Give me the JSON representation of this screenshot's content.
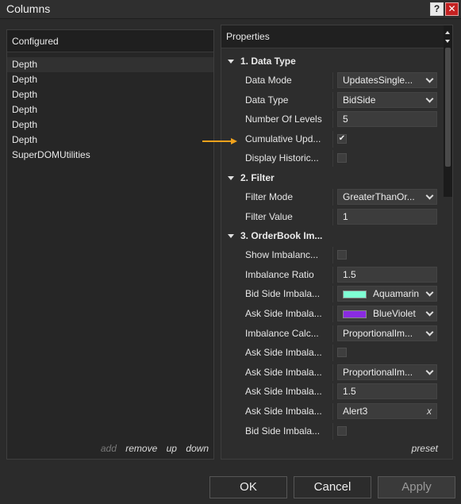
{
  "window": {
    "title": "Columns",
    "help_label": "?",
    "close_label": "✕"
  },
  "left_panel": {
    "header": "Configured",
    "items": [
      "Depth",
      "Depth",
      "Depth",
      "Depth",
      "Depth",
      "Depth",
      "SuperDOMUtilities"
    ],
    "actions": {
      "add": "add",
      "remove": "remove",
      "up": "up",
      "down": "down"
    }
  },
  "right_panel": {
    "header": "Properties",
    "categories": {
      "data_type": "1. Data Type",
      "filter": "2. Filter",
      "orderbook": "3. OrderBook Im..."
    },
    "props": {
      "data_mode": {
        "label": "Data Mode",
        "value": "UpdatesSingle..."
      },
      "data_type": {
        "label": "Data Type",
        "value": "BidSide"
      },
      "number_of_levels": {
        "label": "Number Of Levels",
        "value": "5"
      },
      "cumulative_upd": {
        "label": "Cumulative Upd...",
        "value": "✔"
      },
      "display_historic": {
        "label": "Display Historic..."
      },
      "filter_mode": {
        "label": "Filter Mode",
        "value": "GreaterThanOr..."
      },
      "filter_value": {
        "label": "Filter Value",
        "value": "1"
      },
      "show_imbalance": {
        "label": "Show Imbalanc..."
      },
      "imbalance_ratio": {
        "label": "Imbalance Ratio",
        "value": "1.5"
      },
      "bid_side_color": {
        "label": "Bid Side Imbala...",
        "value": "Aquamarine",
        "color": "#7fffd4"
      },
      "ask_side_color": {
        "label": "Ask Side Imbala...",
        "value": "BlueViolet",
        "color": "#8a2be2"
      },
      "imbalance_calc": {
        "label": "Imbalance Calc...",
        "value": "ProportionalIm..."
      },
      "ask_side_check": {
        "label": "Ask Side Imbala..."
      },
      "ask_side_calc": {
        "label": "Ask Side Imbala...",
        "value": "ProportionalIm..."
      },
      "ask_side_ratio": {
        "label": "Ask Side Imbala...",
        "value": "1.5"
      },
      "ask_side_alert": {
        "label": "Ask Side Imbala...",
        "value": "Alert3",
        "clear": "x"
      },
      "bid_side_check": {
        "label": "Bid Side Imbala..."
      }
    },
    "preset": "preset"
  },
  "buttons": {
    "ok": "OK",
    "cancel": "Cancel",
    "apply": "Apply"
  },
  "colors": {
    "accent_arrow": "#f0a21c",
    "background": "#2b2b2b"
  }
}
